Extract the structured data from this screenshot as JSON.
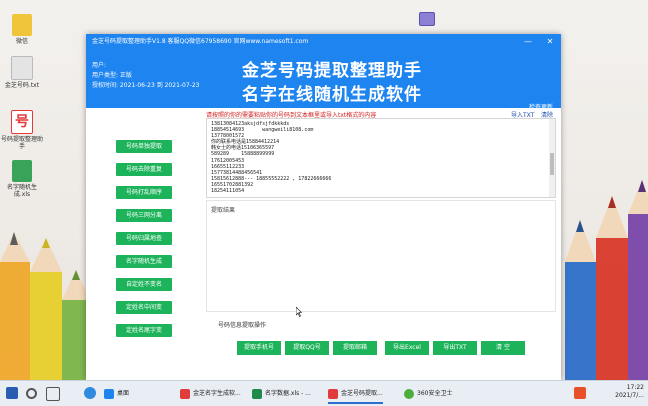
{
  "desktop": {
    "icons": [
      {
        "label": "微信",
        "color": "#f0c53a"
      },
      {
        "label": "金芝号码.txt",
        "color": "#dcdcdc"
      },
      {
        "label": "号码提取整理助手",
        "color": "#e23b3b"
      },
      {
        "label": "名字随机生成.xls",
        "color": "#3aa35a"
      }
    ],
    "top_icon_color": "#8b7fd6"
  },
  "window": {
    "title": "金芝号码提取整理助手V1.8 客服QQ微信67958690 官网www.namesoft1.com",
    "user_label": "用户:",
    "user_type": "用户类型: 正版",
    "license": "授权时间: 2021-06-23 到 2021-07-23",
    "banner_line1": "金芝号码提取整理助手",
    "banner_line2": "名字在线随机生成软件",
    "check_update": "检查更新",
    "minimize_icon": "minimize-icon",
    "close_icon": "close-icon"
  },
  "sidebar": {
    "buttons": [
      "号码单独提取",
      "号码去除重复",
      "号码打乱顺序",
      "号码三网分离",
      "号码归属地查",
      "名字随机生成",
      "自定姓不变名",
      "定姓名中间变",
      "定姓名尾字变"
    ]
  },
  "main": {
    "notice": "请按照的你的需要粘贴你的号码到文本框里或导入txt格式的内容",
    "import_txt": "导入TXT",
    "clear": "清除",
    "input_lines": [
      "13813084123aksjdfsjfdkkkds",
      "18854514693      wangweili8108.com",
      "13778001572",
      "你的联系电话是15884412214",
      "韩女士的电话15106365597",
      "589289    15888899999",
      "17612005453",
      "16655112233",
      "15773814488456541",
      "15815612888--- 18855552222 , 17822666666",
      "16551702881392",
      "18254111054"
    ],
    "result_label": "提取结果",
    "option_label": "号码信息提取操作"
  },
  "actions": [
    "提取手机号",
    "提取QQ号",
    "提取邮箱",
    "导出Excel",
    "导出TXT",
    "清 空"
  ],
  "taskbar": {
    "search_text": "桌面",
    "apps": [
      "金芝名字生成软...",
      "名字数据.xls - ...",
      "金芝号码提取...",
      "360安全卫士"
    ],
    "time": "17:22",
    "date": "2021/7/..."
  },
  "colors": {
    "brand_blue": "#1e84f0",
    "button_green": "#1db35a",
    "notice_red": "#d21b1b"
  }
}
